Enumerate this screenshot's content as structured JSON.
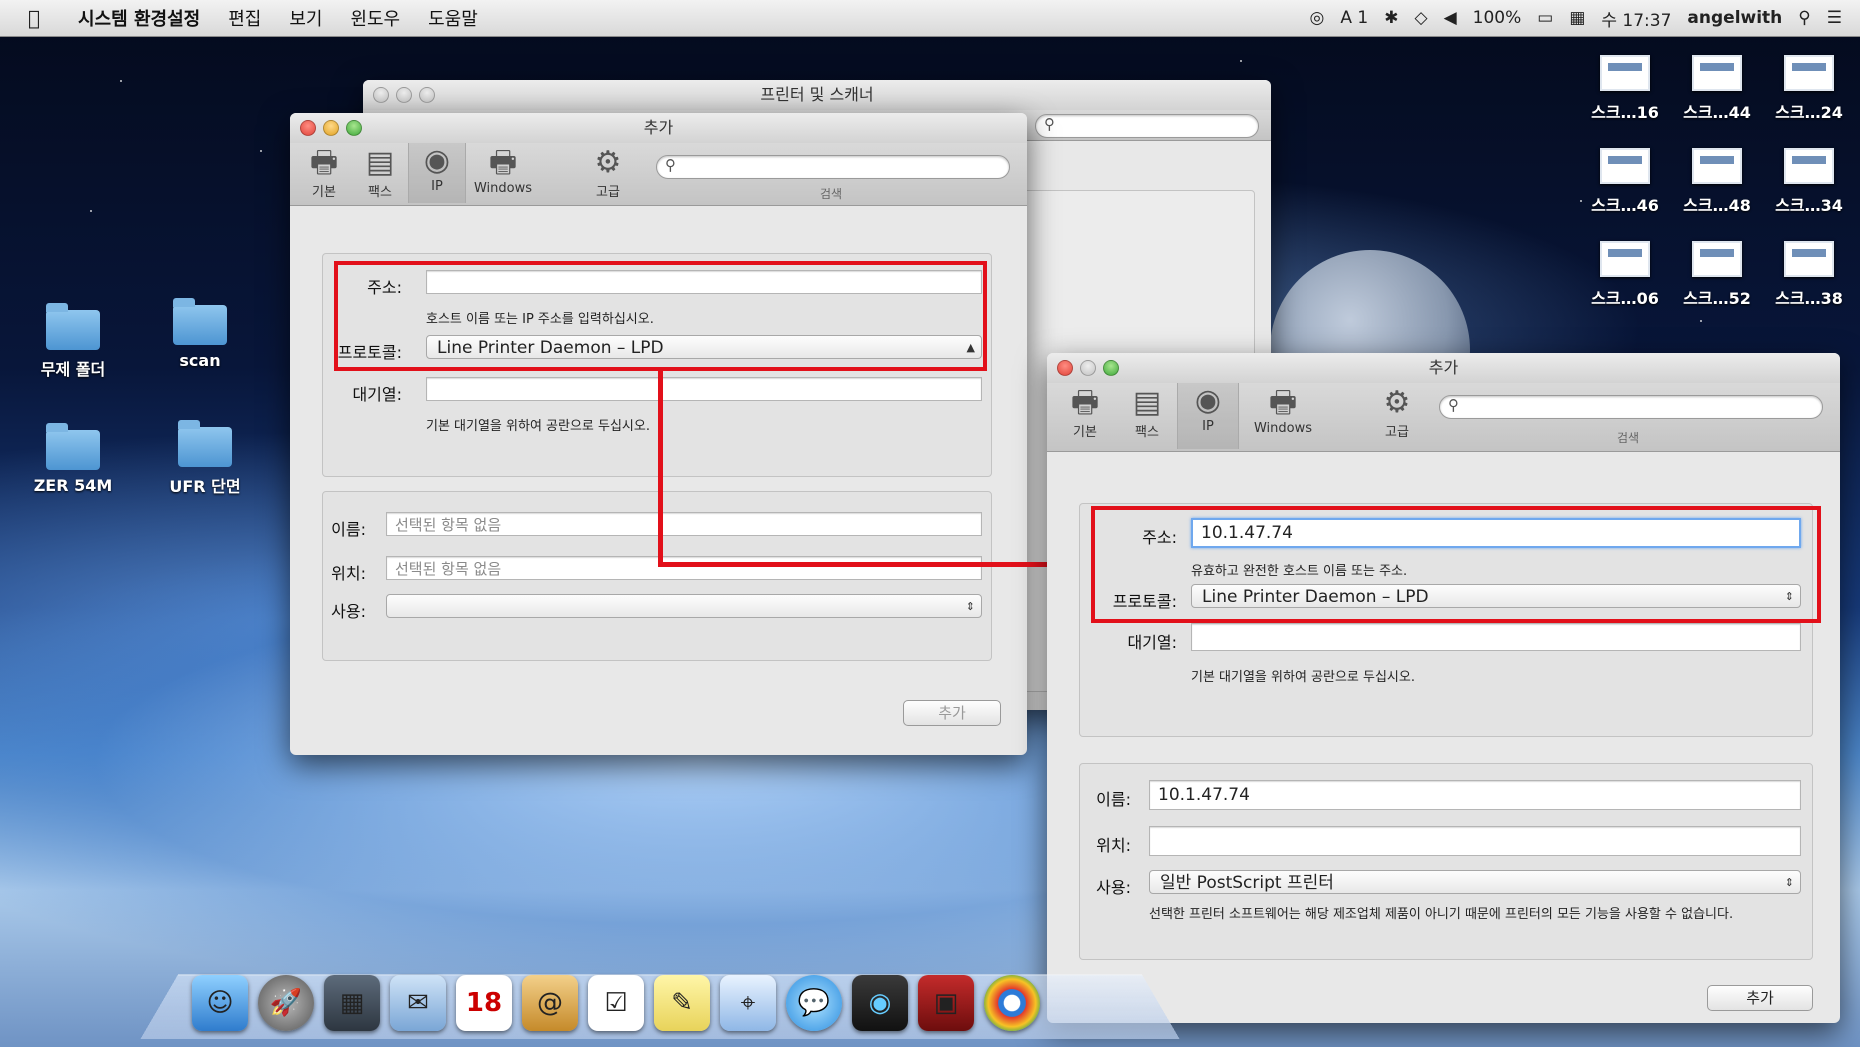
{
  "menubar": {
    "app_name": "시스템 환경설정",
    "menus": [
      "편집",
      "보기",
      "윈도우",
      "도움말"
    ],
    "status": {
      "kbd": "1",
      "battery": "100%",
      "clock": "수 17:37",
      "user": "angelwith"
    }
  },
  "desktop": {
    "folders": [
      "무제 폴더",
      "scan",
      "ZER 54M",
      "UFR 단면"
    ],
    "screenshots": [
      "스크…16",
      "스크…44",
      "스크…24",
      "스크…46",
      "스크…48",
      "스크…34",
      "스크…06",
      "스크…52",
      "스크…38"
    ]
  },
  "back_window": {
    "title": "프린터 및 스캐너"
  },
  "toolbar": {
    "basic": "기본",
    "fax": "팩스",
    "ip": "IP",
    "windows": "Windows",
    "advanced": "고급",
    "search_label": "검색"
  },
  "dialog_left": {
    "title": "추가",
    "address_label": "주소:",
    "address_value": "",
    "address_hint": "호스트 이름 또는 IP 주소를 입력하십시오.",
    "protocol_label": "프로토콜:",
    "protocol_value": "Line Printer Daemon – LPD",
    "queue_label": "대기열:",
    "queue_value": "",
    "queue_hint": "기본 대기열을 위하여 공란으로 두십시오.",
    "name_label": "이름:",
    "name_placeholder": "선택된 항목 없음",
    "location_label": "위치:",
    "location_placeholder": "선택된 항목 없음",
    "use_label": "사용:",
    "use_value": "",
    "add_button": "추가"
  },
  "dialog_right": {
    "title": "추가",
    "address_label": "주소:",
    "address_value": "10.1.47.74",
    "address_hint": "유효하고 완전한 호스트 이름 또는 주소.",
    "protocol_label": "프로토콜:",
    "protocol_value": "Line Printer Daemon – LPD",
    "queue_label": "대기열:",
    "queue_value": "",
    "queue_hint": "기본 대기열을 위하여 공란으로 두십시오.",
    "name_label": "이름:",
    "name_value": "10.1.47.74",
    "location_label": "위치:",
    "location_value": "",
    "use_label": "사용:",
    "use_value": "일반 PostScript 프린터",
    "use_note": "선택한 프린터 소프트웨어는 해당 제조업체 제품이 아니기 때문에 프린터의 모든 기능을 사용할 수 없습니다.",
    "add_button": "추가"
  },
  "dock": {
    "calendar_day": "18"
  },
  "colors": {
    "highlight": "#e2101a",
    "focus_ring": "#6fa8ee"
  }
}
